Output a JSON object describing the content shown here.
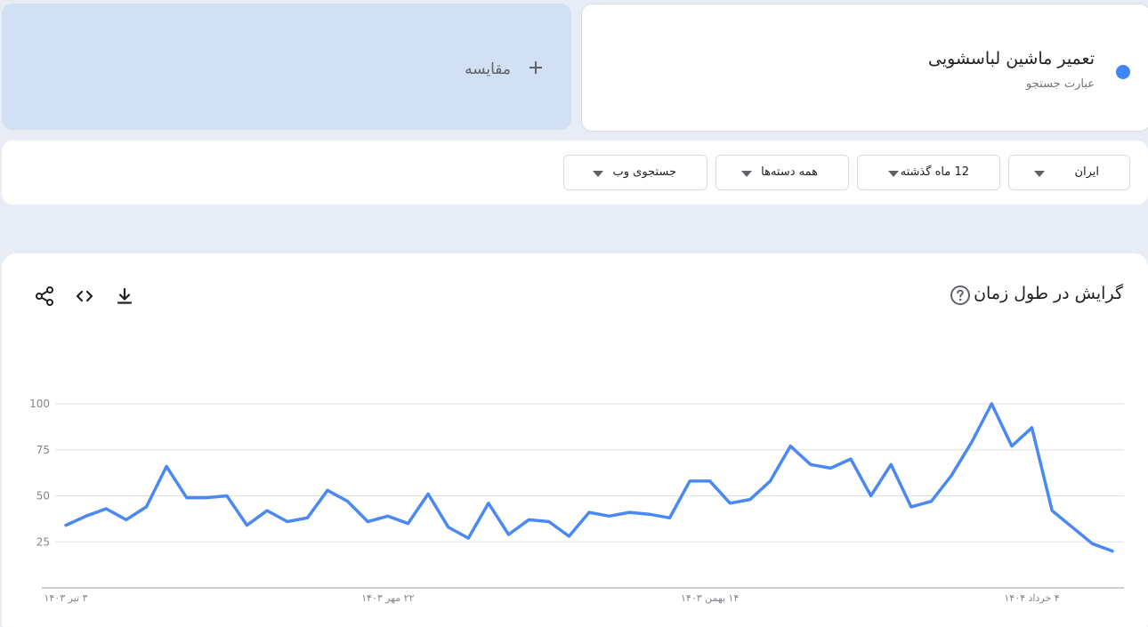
{
  "term": {
    "title": "تعمیر ماشین لباسشویی",
    "subtitle": "عبارت جستجو",
    "color": "#4285f4"
  },
  "compare": {
    "label": "مقایسه",
    "icon": "plus-icon"
  },
  "filters": [
    {
      "label": "ایران",
      "icon": "caret-down-icon"
    },
    {
      "label": "12 ماه گذشته",
      "icon": "caret-down-icon"
    },
    {
      "label": "همه دسته‌ها",
      "icon": "caret-down-icon"
    },
    {
      "label": "جستجوی وب",
      "icon": "caret-down-icon"
    }
  ],
  "chart_header": {
    "title": "گرایش در طول زمان",
    "help_icon": "help-circle-icon",
    "download_icon": "download-icon",
    "embed_icon": "code-icon",
    "share_icon": "share-icon"
  },
  "chart_data": {
    "type": "line",
    "title": "گرایش در طول زمان",
    "xlabel": "",
    "ylabel": "",
    "ylim": [
      0,
      100
    ],
    "y_ticks": [
      25,
      50,
      75,
      100
    ],
    "x_tick_labels": [
      {
        "index": 0,
        "label": "۳ تیر ۱۴۰۳"
      },
      {
        "index": 16,
        "label": "۲۲ مهر ۱۴۰۳"
      },
      {
        "index": 32,
        "label": "۱۴ بهمن ۱۴۰۳"
      },
      {
        "index": 48,
        "label": "۴ خرداد ۱۴۰۴"
      }
    ],
    "grid": true,
    "series": [
      {
        "color": "#4a89f3",
        "values": [
          34,
          39,
          43,
          37,
          44,
          66,
          49,
          49,
          50,
          34,
          42,
          36,
          38,
          53,
          47,
          36,
          39,
          35,
          51,
          33,
          27,
          46,
          29,
          37,
          36,
          28,
          41,
          39,
          41,
          40,
          38,
          58,
          58,
          46,
          48,
          58,
          77,
          67,
          65,
          70,
          50,
          67,
          44,
          47,
          61,
          79,
          100,
          77,
          87,
          42,
          33,
          24,
          20
        ]
      }
    ]
  }
}
